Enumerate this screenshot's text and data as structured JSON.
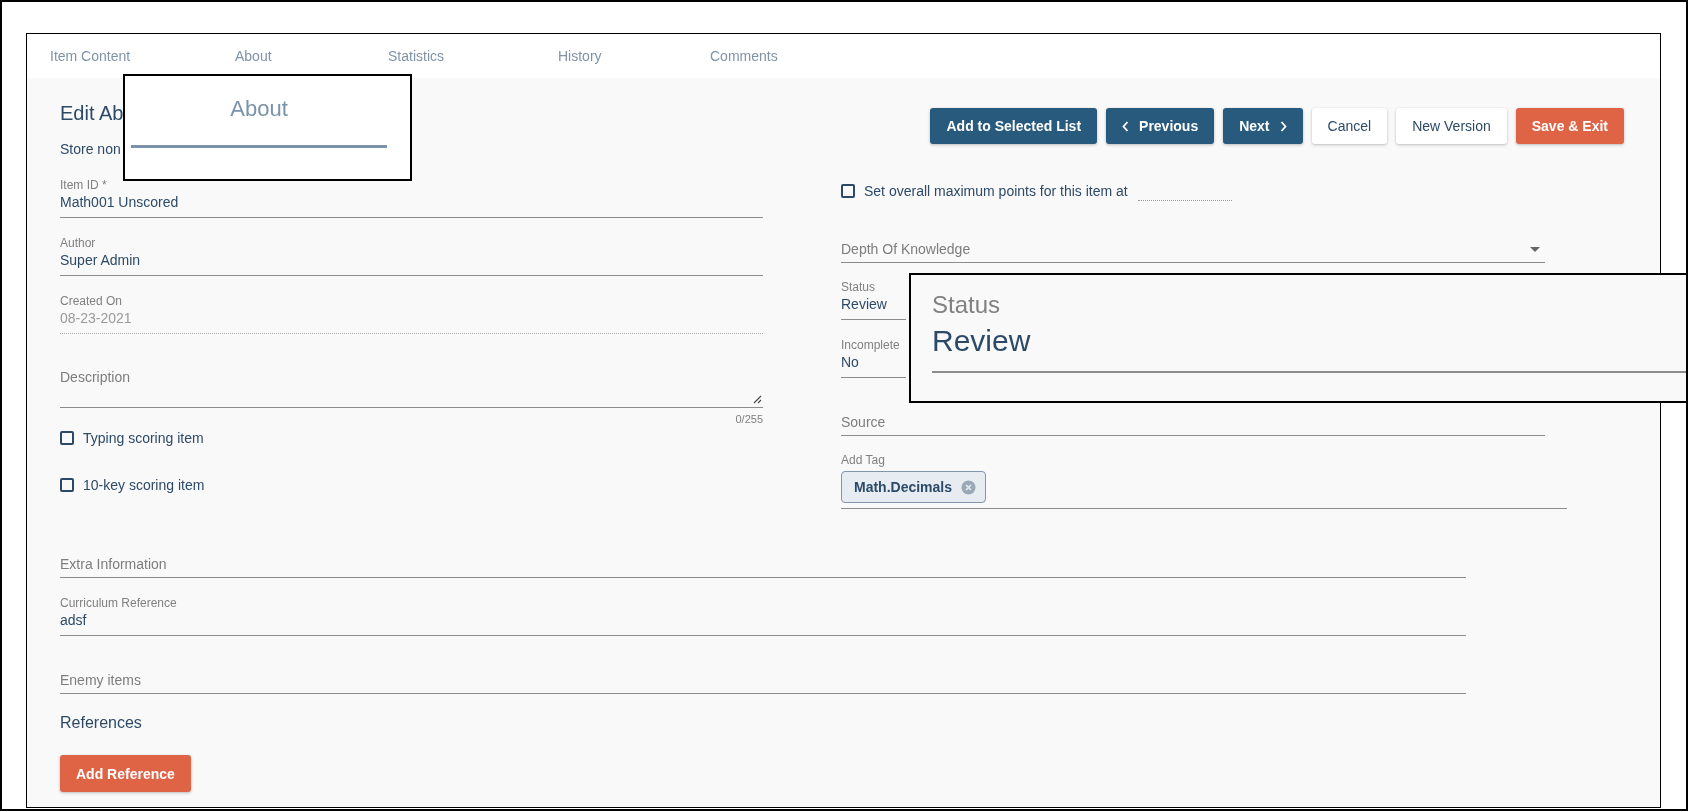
{
  "tabs": [
    {
      "label": "Item Content"
    },
    {
      "label": "About"
    },
    {
      "label": "Statistics"
    },
    {
      "label": "History"
    },
    {
      "label": "Comments"
    }
  ],
  "header": {
    "title": "Edit Ab",
    "subtitle": "Store non"
  },
  "actions": [
    {
      "label": "Add to Selected List",
      "kind": "primary"
    },
    {
      "label": "Previous",
      "kind": "previous"
    },
    {
      "label": "Next",
      "kind": "next"
    },
    {
      "label": "Cancel",
      "kind": "secondary"
    },
    {
      "label": "New Version",
      "kind": "secondary"
    },
    {
      "label": "Save & Exit",
      "kind": "accent"
    }
  ],
  "left_fields": [
    {
      "kind": "text",
      "label": "Item ID *",
      "value": "Math001 Unscored"
    },
    {
      "kind": "text",
      "label": "Author",
      "value": "Super Admin"
    },
    {
      "kind": "readonly",
      "label": "Created On",
      "value": "08-23-2021",
      "disabled": true
    },
    {
      "kind": "textarea",
      "placeholder": "Description",
      "counter": "0/255"
    },
    {
      "kind": "checkbox",
      "label": "Typing scoring item",
      "checked": false
    },
    {
      "kind": "checkbox",
      "label": "10-key scoring item",
      "checked": false
    }
  ],
  "right_fields": [
    {
      "kind": "points",
      "label": "Set overall maximum points for this item at",
      "checked": false
    },
    {
      "kind": "select",
      "placeholder": "Depth Of Knowledge"
    },
    {
      "kind": "text",
      "label": "Status",
      "value": "Review"
    },
    {
      "kind": "text",
      "label": "Incomplete",
      "value": "No"
    },
    {
      "kind": "input",
      "placeholder": "Source"
    },
    {
      "kind": "tags",
      "label": "Add Tag",
      "tags": [
        "Math.Decimals"
      ]
    }
  ],
  "wide_fields": [
    {
      "kind": "input",
      "placeholder": "Extra Information"
    },
    {
      "kind": "text",
      "label": "Curriculum Reference",
      "value": "adsf"
    },
    {
      "kind": "input",
      "placeholder": "Enemy items"
    }
  ],
  "references": {
    "title": "References",
    "button": "Add Reference"
  },
  "callouts": [
    {
      "kind": "tab",
      "label": "About"
    },
    {
      "kind": "field",
      "label": "Status",
      "value": "Review"
    }
  ]
}
